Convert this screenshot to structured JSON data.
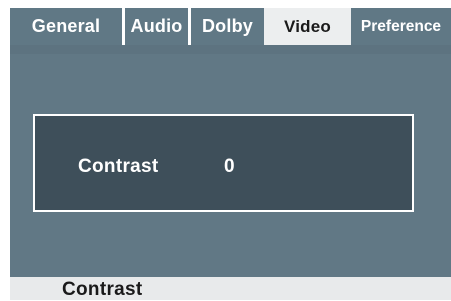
{
  "tabs": [
    {
      "label": "General",
      "active": false
    },
    {
      "label": "Audio",
      "active": false
    },
    {
      "label": "Dolby",
      "active": false
    },
    {
      "label": "Video",
      "active": true
    },
    {
      "label": "Preference",
      "active": false
    }
  ],
  "setting": {
    "label": "Contrast",
    "value": "0"
  },
  "status": {
    "text": "Contrast"
  },
  "colors": {
    "tab_bar": "#607885",
    "active_tab": "#eceeef",
    "content_bg": "#617885",
    "panel_bg": "#3e4f5a",
    "panel_border": "#ffffff",
    "status_bar": "#e8eaeb"
  }
}
